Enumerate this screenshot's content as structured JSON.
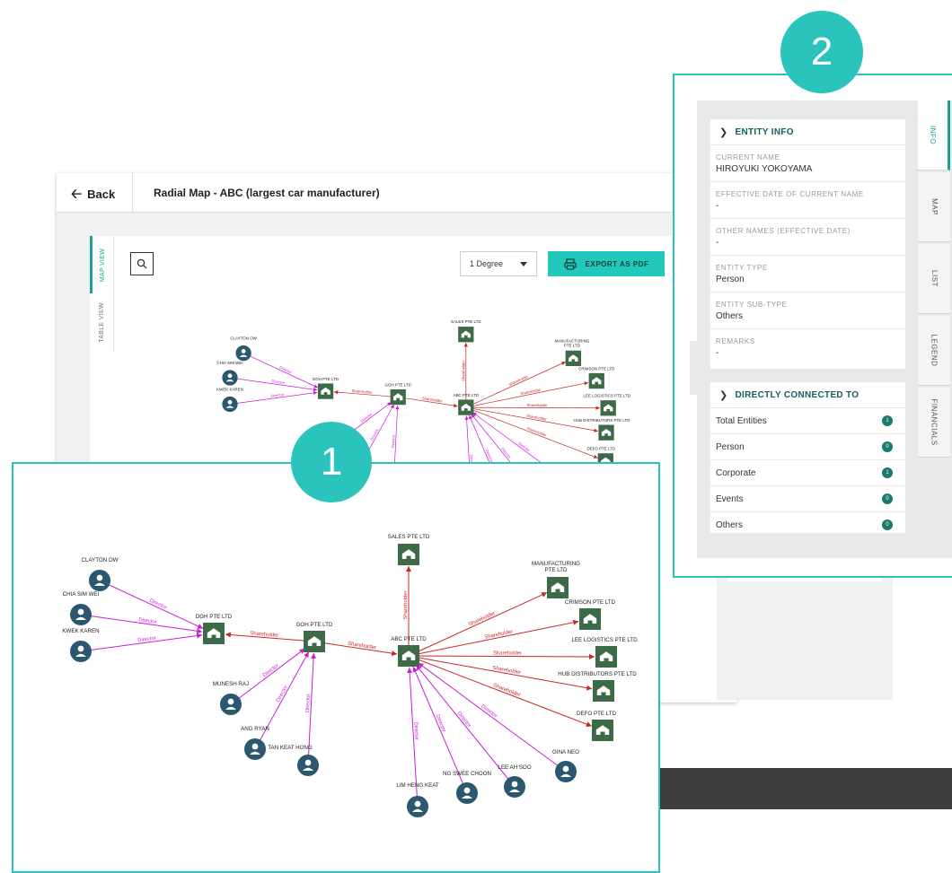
{
  "app": {
    "back_label": "Back",
    "title": "Radial Map - ABC (largest car manufacturer)",
    "view_tabs": [
      "MAP VIEW",
      "TABLE VIEW"
    ],
    "degree_selected": "1 Degree",
    "export_label": "EXPORT AS PDF"
  },
  "callouts": [
    "1",
    "2"
  ],
  "map": {
    "persons": [
      "CLAYTON OW",
      "CHIA SIM WEI",
      "KWEK KAREN",
      "MUNESH RAJ",
      "ANG RYAN",
      "TAN KEAT HONG",
      "LIM HENG KEAT",
      "NG SWEE CHOON",
      "LEE AH SOO",
      "GINA NEO"
    ],
    "corporates": [
      "DGH PTE LTD",
      "GOH PTE LTD",
      "ABC PTE LTD",
      "SALES PTE LTD",
      "MANUFACTURING PTE LTD",
      "CRIMSON PTE LTD",
      "LEE LOGISTICS PTE LTD",
      "HUB DISTRIBUTORS PTE LTD",
      "DEFO PTE LTD"
    ],
    "edge_labels": {
      "director": "Director",
      "shareholder": "Shareholder"
    }
  },
  "info_panel": {
    "entity_info_header": "ENTITY INFO",
    "fields": [
      {
        "label": "CURRENT NAME",
        "value": "HIROYUKI YOKOYAMA"
      },
      {
        "label": "EFFECTIVE DATE OF CURRENT NAME",
        "value": "-"
      },
      {
        "label": "OTHER NAMES (EFFECTIVE DATE)",
        "value": "-"
      },
      {
        "label": "ENTITY TYPE",
        "value": "Person"
      },
      {
        "label": "ENTITY SUB-TYPE",
        "value": "Others"
      },
      {
        "label": "REMARKS",
        "value": "-"
      }
    ],
    "connected_header": "DIRECTLY CONNECTED TO",
    "connected": [
      {
        "label": "Total Entities",
        "count": "1"
      },
      {
        "label": "Person",
        "count": "0"
      },
      {
        "label": "Corporate",
        "count": "1"
      },
      {
        "label": "Events",
        "count": "0"
      },
      {
        "label": "Others",
        "count": "0"
      }
    ],
    "side_tabs": [
      "INFO",
      "MAP",
      "LIST",
      "LEGEND",
      "FINANCIALS"
    ]
  },
  "colors": {
    "accent": "#2bc4bd",
    "node_green": "#3d6b47",
    "person_blue": "#2b5770",
    "director_edge": "#c81fd6",
    "shareholder_edge": "#c62828"
  }
}
